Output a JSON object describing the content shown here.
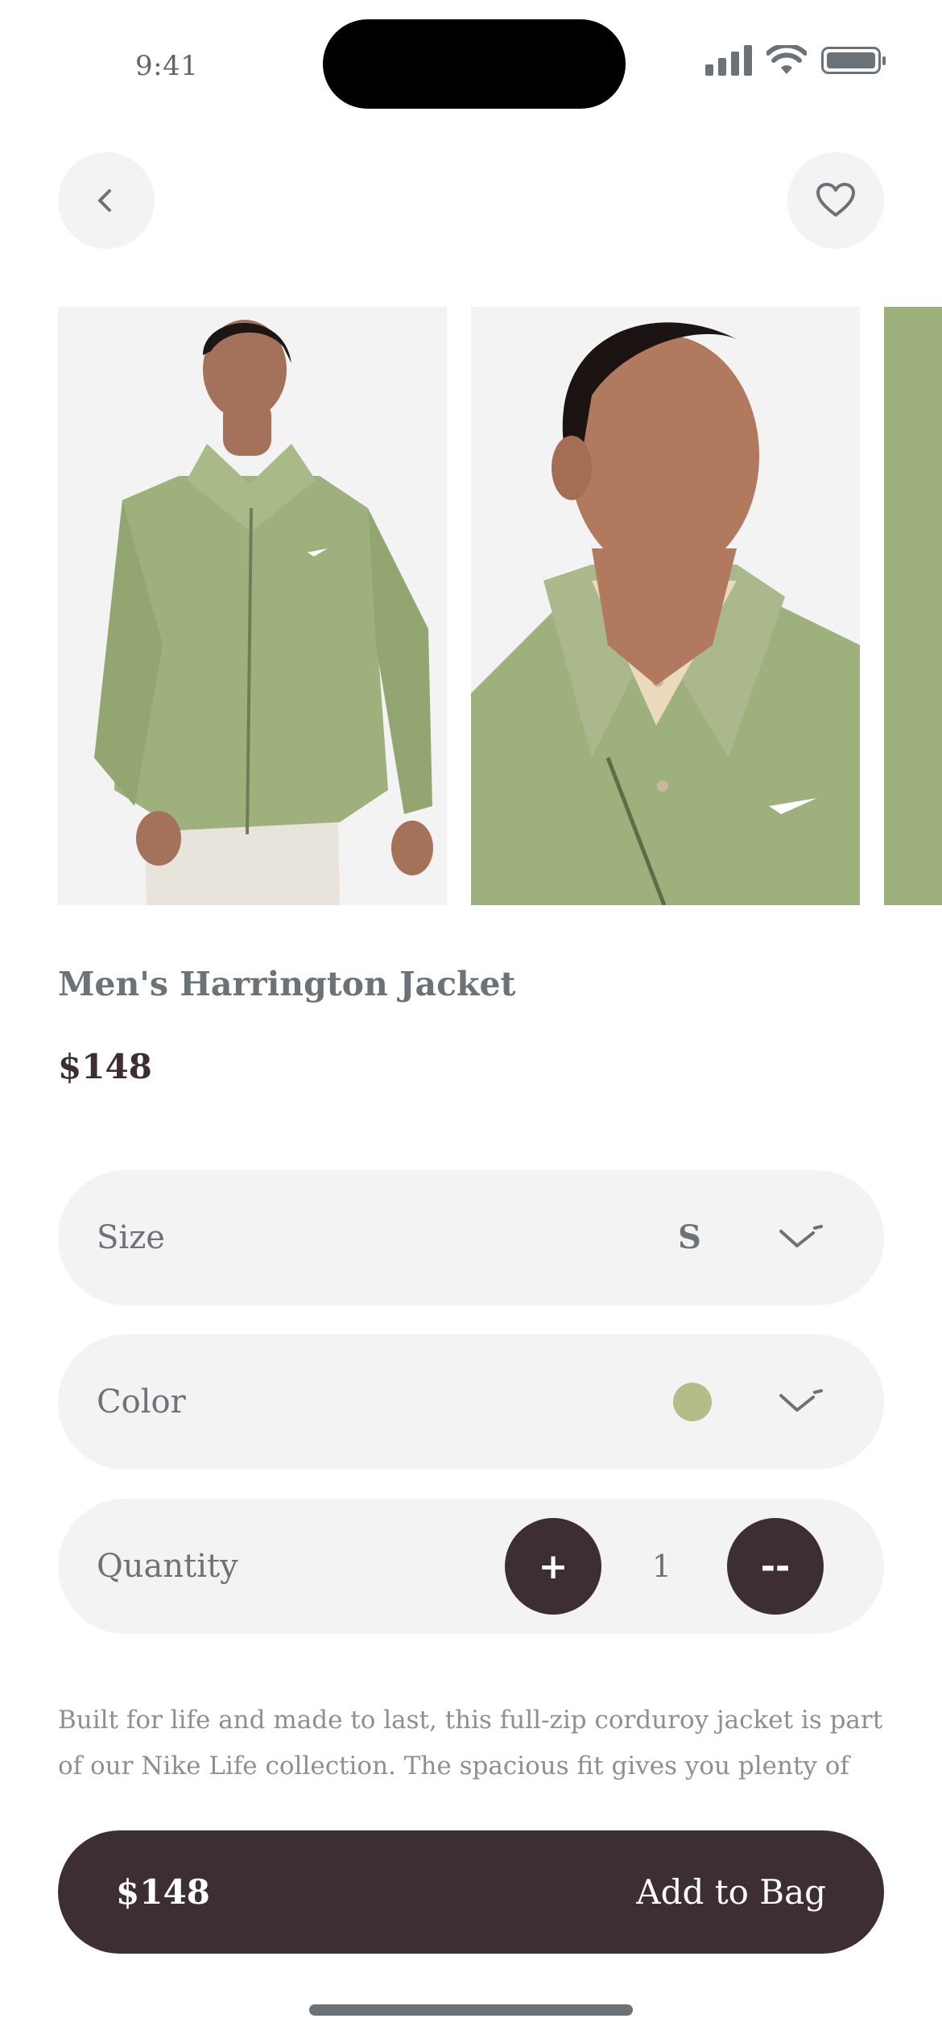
{
  "status_bar": {
    "time": "9:41"
  },
  "nav": {
    "back_icon": "chevron-left-icon",
    "favorite_icon": "heart-icon"
  },
  "product": {
    "name": "Men's Harrington Jacket",
    "price": "$148",
    "description": "Built for life and made to last, this full-zip corduroy jacket is part of our Nike Life collection. The spacious fit gives you plenty of room to"
  },
  "options": {
    "size_label": "Size",
    "size_value": "S",
    "color_label": "Color",
    "color_value": "#b4bd87",
    "quantity_label": "Quantity",
    "quantity_value": "1",
    "plus_label": "+",
    "minus_label": "--"
  },
  "cta": {
    "price": "$148",
    "label": "Add to Bag"
  },
  "colors": {
    "primary_dark": "#3d2e31",
    "text_gray": "#6b7378",
    "surface": "#f3f3f3",
    "swatch": "#b4bd87"
  }
}
